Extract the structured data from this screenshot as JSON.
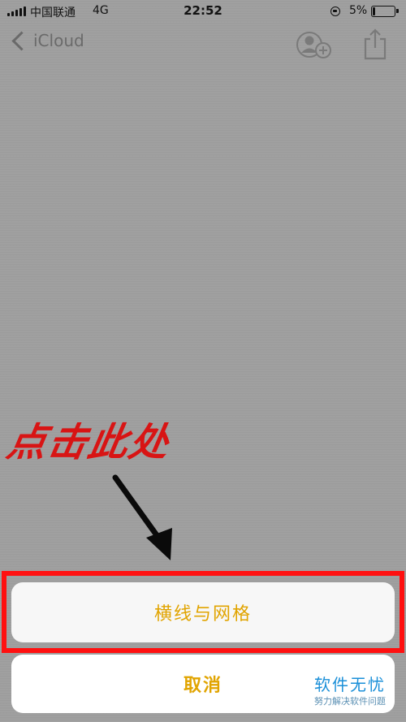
{
  "status_bar": {
    "carrier": "中国联通",
    "network": "4G",
    "time": "22:52",
    "battery_percent": "5%"
  },
  "nav_bar": {
    "back_label": "iCloud",
    "icons": [
      "add-person-icon",
      "share-icon"
    ]
  },
  "annotation": {
    "text": "点击此处"
  },
  "action_sheet": {
    "option_label": "横线与网格",
    "cancel_label": "取消"
  },
  "watermark": {
    "title": "软件无忧",
    "subtitle": "努力解决软件问题"
  },
  "colors": {
    "accent": "#e1a400",
    "annotation_red": "#d81414",
    "highlight_red": "#ff1010",
    "dim_background": "#9f9f9f"
  }
}
